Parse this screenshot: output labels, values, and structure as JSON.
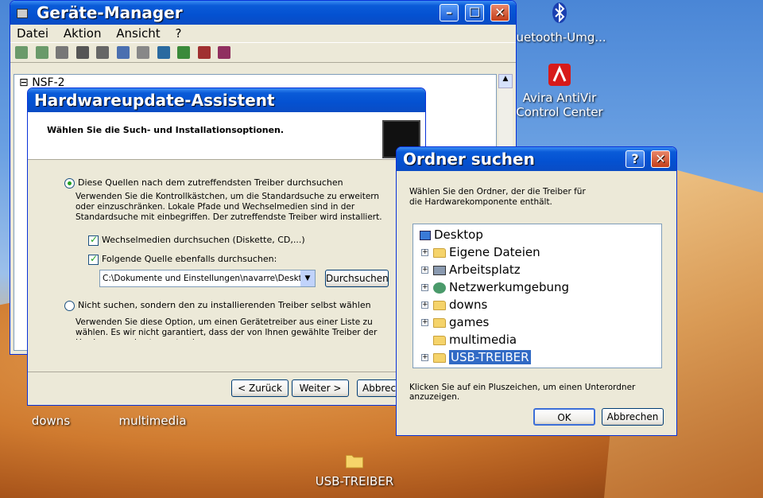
{
  "desktop": {
    "icons": [
      {
        "label": "luetooth-Umg...",
        "icon": "bluetooth-icon"
      },
      {
        "label": "Avira AntiVir Control Center",
        "icon": "avira-icon"
      },
      {
        "label": "downs",
        "icon": "folder-icon"
      },
      {
        "label": "multimedia",
        "icon": "folder-icon"
      },
      {
        "label": "USB-TREIBER",
        "icon": "folder-icon"
      }
    ]
  },
  "device_manager": {
    "title": "Geräte-Manager",
    "menu": [
      "Datei",
      "Aktion",
      "Ansicht",
      "?"
    ],
    "tree_root": "NSF-2"
  },
  "wizard": {
    "title": "Hardwareupdate-Assistent",
    "heading": "Wählen Sie die Such- und Installationsoptionen.",
    "option1": "Diese Quellen nach dem zutreffendsten Treiber durchsuchen",
    "option1_desc": "Verwenden Sie die Kontrollkästchen, um die Standardsuche zu erweitern oder einzuschränken. Lokale Pfade und Wechselmedien sind in der Standardsuche mit einbegriffen. Der zutreffendste Treiber wird installiert.",
    "check1": "Wechselmedien durchsuchen (Diskette, CD,...)",
    "check2": "Folgende Quelle ebenfalls durchsuchen:",
    "path": "C:\\Dokumente und Einstellungen\\navarre\\Desktop",
    "browse": "Durchsuchen",
    "option2": "Nicht suchen, sondern den zu installierenden Treiber selbst wählen",
    "option2_desc": "Verwenden Sie diese Option, um einen Gerätetreiber aus einer Liste zu wählen. Es wir nicht garantiert, dass der von Ihnen gewählte Treiber der Hardware am besten entspri",
    "back": "< Zurück",
    "next": "Weiter >",
    "cancel": "Abbrech"
  },
  "folder_dialog": {
    "title": "Ordner suchen",
    "prompt": "Wählen Sie den Ordner, der die Treiber für die Hardwarekomponente enthält.",
    "items": [
      {
        "label": "Desktop",
        "icon": "desktop-icon"
      },
      {
        "label": "Eigene Dateien",
        "icon": "documents-icon"
      },
      {
        "label": "Arbeitsplatz",
        "icon": "computer-icon"
      },
      {
        "label": "Netzwerkumgebung",
        "icon": "network-icon"
      },
      {
        "label": "downs",
        "icon": "folder-icon"
      },
      {
        "label": "games",
        "icon": "folder-icon"
      },
      {
        "label": "multimedia",
        "icon": "folder-icon"
      },
      {
        "label": "USB-TREIBER",
        "icon": "folder-icon"
      }
    ],
    "hint": "Klicken Sie auf ein Pluszeichen, um einen Unterordner anzuzeigen.",
    "ok": "OK",
    "cancel": "Abbrechen",
    "help": "?"
  }
}
